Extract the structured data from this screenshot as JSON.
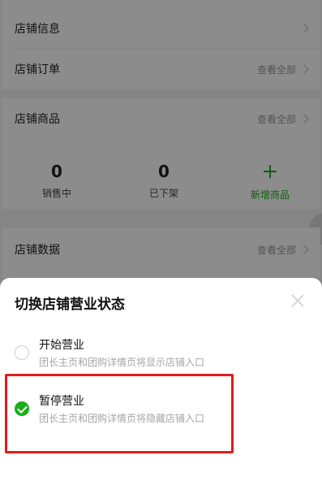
{
  "store": {
    "info_label": "店铺信息",
    "orders_label": "店铺订单",
    "orders_view_all": "查看全部",
    "products_label": "店铺商品",
    "products_view_all": "查看全部",
    "stats": [
      {
        "value": "0",
        "label": "销售中"
      },
      {
        "value": "0",
        "label": "已下架"
      }
    ],
    "add_product_label": "新增商品",
    "data_label": "店铺数据",
    "data_view_all": "查看全部"
  },
  "sheet": {
    "title": "切换店铺营业状态",
    "options": [
      {
        "title": "开始营业",
        "desc": "团长主页和团购详情页将显示店铺入口",
        "selected": false
      },
      {
        "title": "暂停营业",
        "desc": "团长主页和团购详情页将隐藏店铺入口",
        "selected": true
      }
    ]
  },
  "colors": {
    "accent": "#1aad19",
    "highlight": "#e21b1b"
  }
}
